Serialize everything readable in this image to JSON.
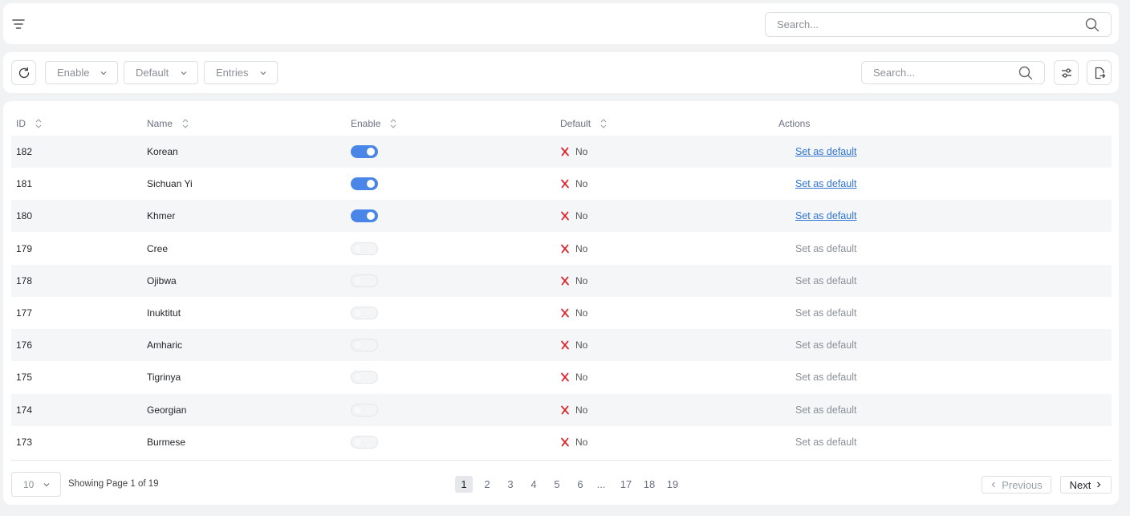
{
  "header": {
    "search_placeholder": "Search..."
  },
  "toolbar": {
    "filters": [
      {
        "label": "Enable"
      },
      {
        "label": "Default"
      },
      {
        "label": "Entries"
      }
    ],
    "search_placeholder": "Search..."
  },
  "table": {
    "columns": [
      "ID",
      "Name",
      "Enable",
      "Default",
      "Actions"
    ],
    "rows": [
      {
        "id": "182",
        "name": "Korean",
        "enabled": true,
        "default": "No",
        "action": "Set as default"
      },
      {
        "id": "181",
        "name": "Sichuan Yi",
        "enabled": true,
        "default": "No",
        "action": "Set as default"
      },
      {
        "id": "180",
        "name": "Khmer",
        "enabled": true,
        "default": "No",
        "action": "Set as default"
      },
      {
        "id": "179",
        "name": "Cree",
        "enabled": false,
        "default": "No",
        "action": "Set as default"
      },
      {
        "id": "178",
        "name": "Ojibwa",
        "enabled": false,
        "default": "No",
        "action": "Set as default"
      },
      {
        "id": "177",
        "name": "Inuktitut",
        "enabled": false,
        "default": "No",
        "action": "Set as default"
      },
      {
        "id": "176",
        "name": "Amharic",
        "enabled": false,
        "default": "No",
        "action": "Set as default"
      },
      {
        "id": "175",
        "name": "Tigrinya",
        "enabled": false,
        "default": "No",
        "action": "Set as default"
      },
      {
        "id": "174",
        "name": "Georgian",
        "enabled": false,
        "default": "No",
        "action": "Set as default"
      },
      {
        "id": "173",
        "name": "Burmese",
        "enabled": false,
        "default": "No",
        "action": "Set as default"
      }
    ]
  },
  "pagination": {
    "page_size": "10",
    "info": "Showing Page 1 of 19",
    "pages": [
      "1",
      "2",
      "3",
      "4",
      "5",
      "6",
      "...",
      "17",
      "18",
      "19"
    ],
    "current": "1",
    "previous_label": "Previous",
    "next_label": "Next"
  },
  "colors": {
    "accent": "#4a86e8",
    "link": "#2f74d0",
    "danger": "#d9262c"
  }
}
